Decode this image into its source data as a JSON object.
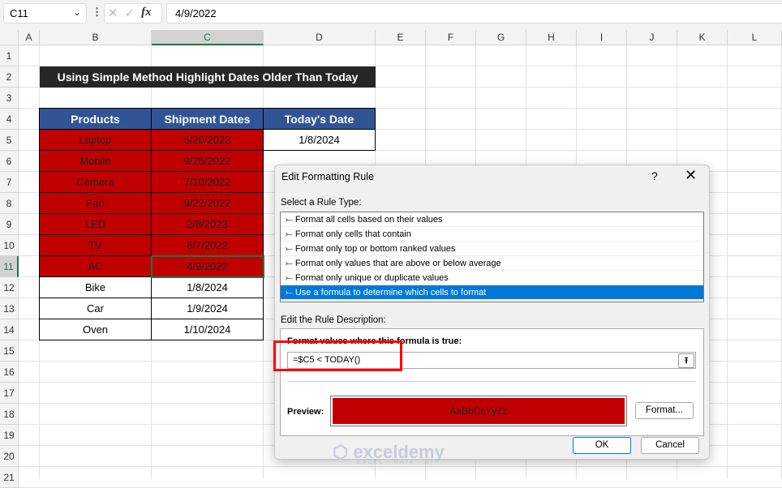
{
  "formula_bar": {
    "name_box": "C11",
    "formula": "4/9/2022"
  },
  "columns": [
    "A",
    "B",
    "C",
    "D",
    "E",
    "F",
    "G",
    "H",
    "I",
    "J",
    "K",
    "L"
  ],
  "rows": [
    "1",
    "2",
    "3",
    "4",
    "5",
    "6",
    "7",
    "8",
    "9",
    "10",
    "11",
    "12",
    "13",
    "14",
    "15",
    "16",
    "17",
    "18",
    "19",
    "20",
    "21"
  ],
  "sheet": {
    "title": "Using Simple Method Highlight Dates Older Than Today",
    "headers": [
      "Products",
      "Shipment Dates",
      "Today's Date"
    ],
    "today": "1/8/2024",
    "data": [
      {
        "product": "Laptop",
        "date": "5/20/2022",
        "highlight": true
      },
      {
        "product": "Mobile",
        "date": "9/25/2022",
        "highlight": true
      },
      {
        "product": "Camera",
        "date": "7/10/2022",
        "highlight": true
      },
      {
        "product": "Fan",
        "date": "9/22/2022",
        "highlight": true
      },
      {
        "product": "LED",
        "date": "2/8/2023",
        "highlight": true
      },
      {
        "product": "TV",
        "date": "8/7/2022",
        "highlight": true
      },
      {
        "product": "AC",
        "date": "4/9/2022",
        "highlight": true
      },
      {
        "product": "Bike",
        "date": "1/8/2024",
        "highlight": false
      },
      {
        "product": "Car",
        "date": "1/9/2024",
        "highlight": false
      },
      {
        "product": "Oven",
        "date": "1/10/2024",
        "highlight": false
      }
    ]
  },
  "dialog": {
    "title": "Edit Formatting Rule",
    "help": "?",
    "close": "✕",
    "rule_type_label": "Select a Rule Type:",
    "rule_types": [
      "Format all cells based on their values",
      "Format only cells that contain",
      "Format only top or bottom ranked values",
      "Format only values that are above or below average",
      "Format only unique or duplicate values",
      "Use a formula to determine which cells to format"
    ],
    "desc_label": "Edit the Rule Description:",
    "formula_label": "Format values where this formula is true:",
    "formula": "=$C5 < TODAY()",
    "preview_label": "Preview:",
    "preview_text": "AaBbCcYyZz",
    "format_btn": "Format...",
    "ok": "OK",
    "cancel": "Cancel"
  },
  "watermark": {
    "name": "exceldemy",
    "tag": "EXCEL · DATA · BI"
  },
  "colors": {
    "header": "#305496",
    "highlight": "#c00000",
    "title_bg": "#262626",
    "selected": "#0078d7"
  }
}
